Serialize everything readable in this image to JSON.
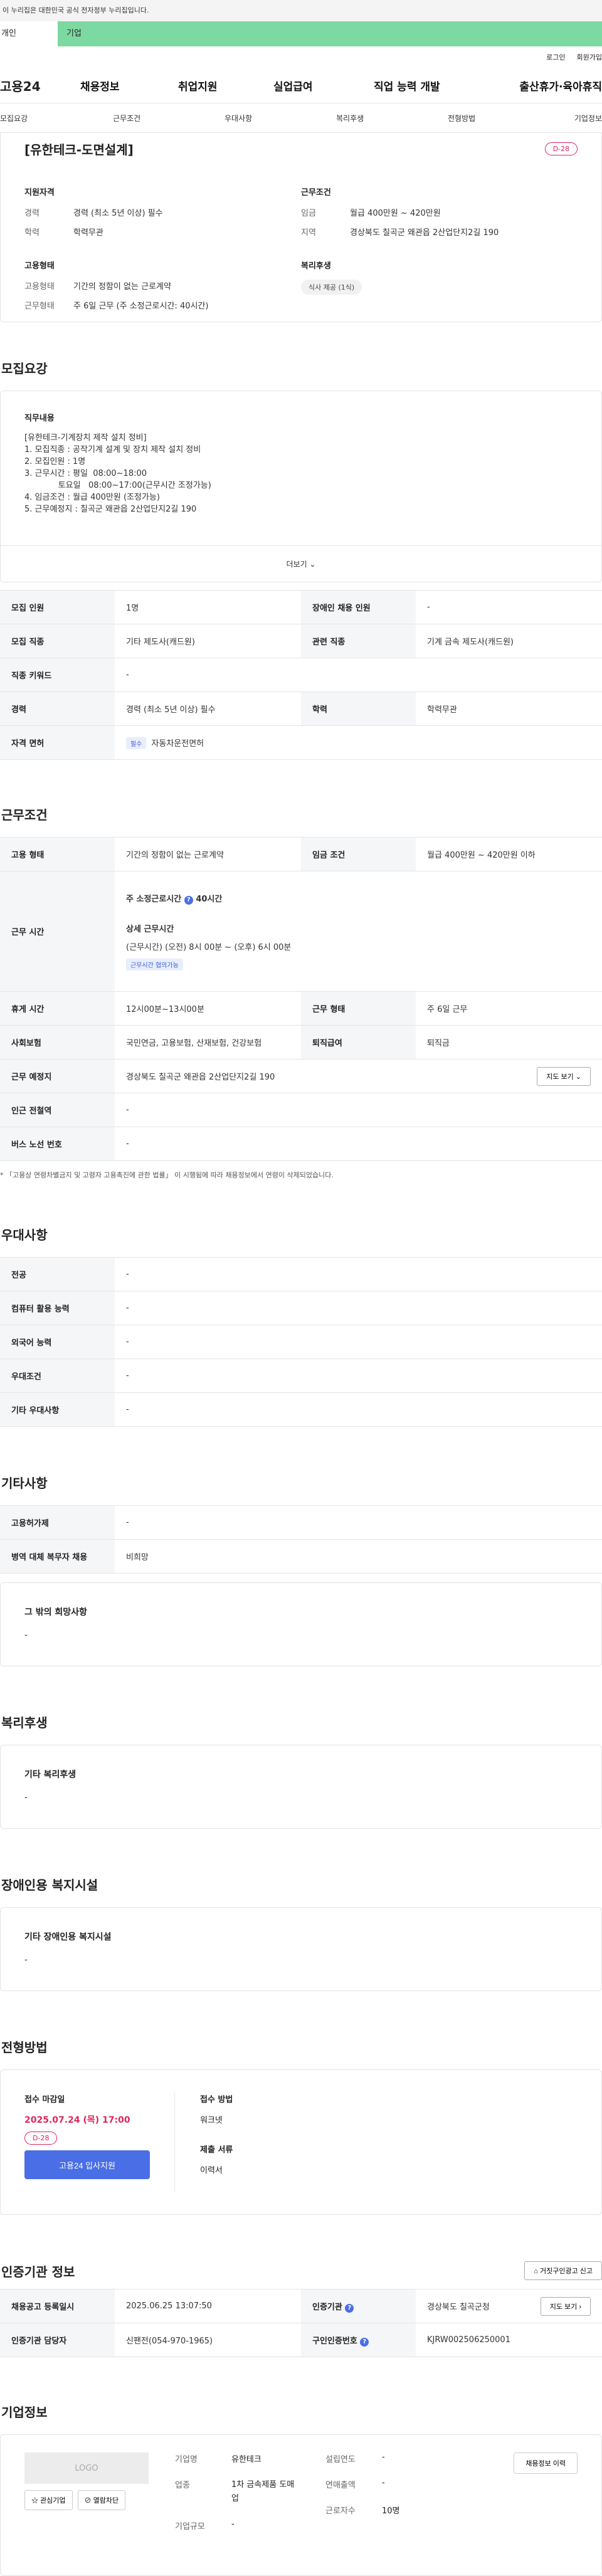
{
  "gov_banner": "이 누리집은 대한민국 공식 전자정부 누리집입니다.",
  "tabs": [
    "개인",
    "기업"
  ],
  "util": [
    "로그인",
    "회원가입"
  ],
  "logo": "고용24",
  "gnb": [
    "채용정보",
    "취업지원",
    "실업급여",
    "직업 능력 개발",
    "출산휴가·육아휴직"
  ],
  "anchor_nav": [
    "모집요강",
    "근무조건",
    "우대사항",
    "복리후생",
    "전형방법",
    "기업정보"
  ],
  "summary": {
    "title": "[유한테크-도면설계]",
    "dday": "D-28",
    "qual_title": "지원자격",
    "qual": [
      {
        "k": "경력",
        "v": "경력 (최소 5년 이상) 필수"
      },
      {
        "k": "학력",
        "v": "학력무관"
      }
    ],
    "cond_title": "근무조건",
    "cond": [
      {
        "k": "임금",
        "v": "월급 400만원 ~ 420만원"
      },
      {
        "k": "지역",
        "v": "경상북도 칠곡군 왜관읍 2산업단지2길 190"
      }
    ],
    "emp_title": "고용형태",
    "emp": [
      {
        "k": "고용형태",
        "v": "기간의 정함이 없는 근로계약"
      },
      {
        "k": "근무형태",
        "v": "주 6일 근무 (주 소정근로시간: 40시간)"
      }
    ],
    "welfare_title": "복리후생",
    "welfare_pill": "식사 제공 (1식)"
  },
  "recruit": {
    "title": "모집요강",
    "desc_label": "직무내용",
    "desc_lines": [
      "[유한테크-기계장치 제작 설치 정비]",
      "",
      "1. 모집직종 : 공작기계 설계 및 장치 제작 설치 정비",
      "2. 모집인원 : 1명",
      "3. 근무시간 : 평일  08:00~18:00",
      "             토요일   08:00~17:00(근무시간 조정가능)",
      "4. 임금조건 : 월급 400만원 (조정가능)",
      "5. 근무예정지 : 칠곡군 왜관읍 2산업단지2길 190"
    ],
    "more": "더보기",
    "rows": [
      {
        "k1": "모집 인원",
        "v1": "1명",
        "k2": "장애인 채용 인원",
        "v2": "-"
      },
      {
        "k1": "모집 직종",
        "v1": "기타 제도사(캐드원)",
        "k2": "관련 직종",
        "v2": "기계 금속 제도사(캐드원)"
      },
      {
        "k1": "직종 키워드",
        "v1": "-"
      },
      {
        "k1": "경력",
        "v1": "경력 (최소 5년 이상) 필수",
        "k2": "학력",
        "v2": "학력무관"
      },
      {
        "k1": "자격 면허",
        "tag": "필수",
        "v1": "자동차운전면허"
      }
    ]
  },
  "work": {
    "title": "근무조건",
    "employment_k": "고용 형태",
    "employment_v": "기간의 정함이 없는 근로계약",
    "wage_k": "임금 조건",
    "wage_v": "월급 400만원 ~ 420만원 이하",
    "hours_k": "근무 시간",
    "hours_main": "주 소정근로시간",
    "hours_main_val": "40시간",
    "hours_detail_label": "상세 근무시간",
    "hours_detail": "(근무시간) (오전) 8시 00분 ~ (오후) 6시 00분",
    "hours_tag": "근무시간 협의가능",
    "rest_k": "휴게 시간",
    "rest_v": "12시00분~13시00분",
    "form_k": "근무 형태",
    "form_v": "주 6일 근무",
    "ins_k": "사회보험",
    "ins_v": "국민연금, 고용보험, 산재보험, 건강보험",
    "ret_k": "퇴직급여",
    "ret_v": "퇴직금",
    "loc_k": "근무 예정지",
    "loc_v": "경상북도 칠곡군 왜관읍 2산업단지2길 190",
    "map_btn": "지도 보기",
    "subway_k": "인근 전철역",
    "subway_v": "-",
    "bus_k": "버스 노선 번호",
    "bus_v": "-",
    "note": "* 「고용상 연령차별금지 및 고령자 고용촉진에 관한 법률」 이 시행됨에 따라 채용정보에서 연령이 삭제되었습니다."
  },
  "pref": {
    "title": "우대사항",
    "rows": [
      {
        "k": "전공",
        "v": "-"
      },
      {
        "k": "컴퓨터 활용 능력",
        "v": "-"
      },
      {
        "k": "외국어 능력",
        "v": "-"
      },
      {
        "k": "우대조건",
        "v": "-"
      },
      {
        "k": "기타 우대사항",
        "v": "-"
      }
    ]
  },
  "etc": {
    "title": "기타사항",
    "rows": [
      {
        "k": "고용허가제",
        "v": "-"
      },
      {
        "k": "병역 대체 복무자 채용",
        "v": "비희망"
      }
    ],
    "box_title": "그 밖의 희망사항",
    "box_value": "-"
  },
  "welfare": {
    "title": "복리후생",
    "box_title": "기타 복리후생",
    "box_value": "-"
  },
  "disabled": {
    "title": "장애인용 복지시설",
    "box_title": "기타 장애인용 복지시설",
    "box_value": "-"
  },
  "apply": {
    "title": "전형방법",
    "deadline_label": "접수 마감일",
    "deadline": "2025.07.24 (목) 17:00",
    "dday": "D-28",
    "btn": "고용24 입사지원",
    "method_label": "접수 방법",
    "method": "워크넷",
    "docs_label": "제출 서류",
    "docs": "이력서"
  },
  "agency": {
    "title": "인증기관 정보",
    "report_btn": "거짓구인광고 신고",
    "reg_k": "채용공고 등록일시",
    "reg_v": "2025.06.25 13:07:50",
    "org_k": "인증기관",
    "org_v": "경상북도 칠곡군청",
    "map_btn": "지도 보기",
    "mgr_k": "인증기관 담당자",
    "mgr_v": "신팬전(054-970-1965)",
    "id_k": "구인인증번호",
    "id_v": "KJRW002506250001"
  },
  "company": {
    "title": "기업정보",
    "logo_text": "LOGO",
    "fav_btn": "관심기업",
    "block_btn": "열람차단",
    "name_k": "기업명",
    "name_v": "유한테크",
    "ind_k": "업종",
    "ind_v": "1차 금속제품 도매업",
    "size_k": "기업규모",
    "size_v": "-",
    "year_k": "설립연도",
    "year_v": "-",
    "sales_k": "연매출액",
    "sales_v": "-",
    "emp_k": "근로자수",
    "emp_v": "10명",
    "history_btn": "채용정보 이력"
  }
}
